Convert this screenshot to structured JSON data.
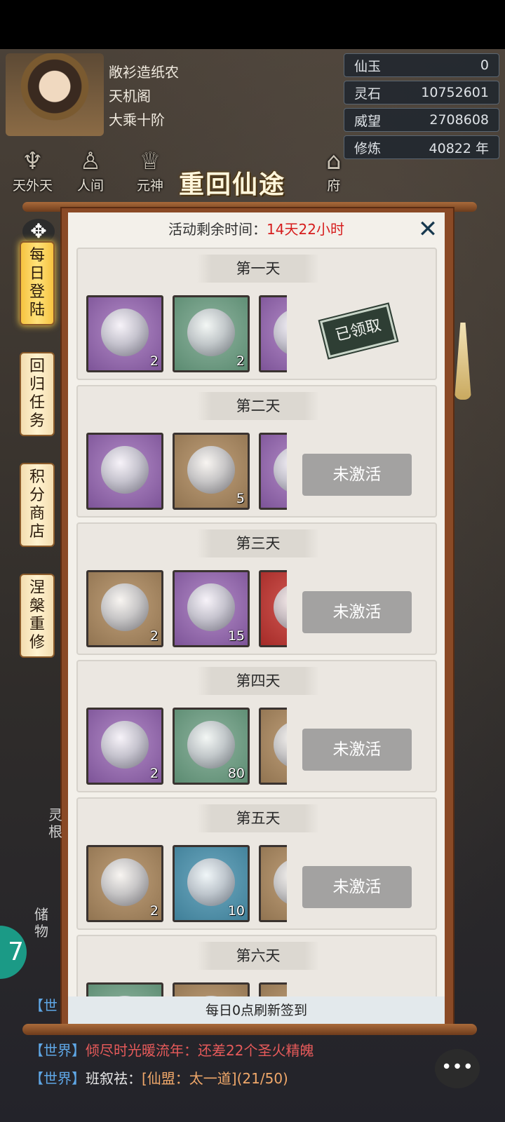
{
  "player": {
    "name": "敞衫造纸农",
    "sect": "天机阁",
    "realm": "大乘十阶"
  },
  "stats": [
    {
      "label": "仙玉",
      "value": "0"
    },
    {
      "label": "灵石",
      "value": "10752601"
    },
    {
      "label": "威望",
      "value": "2708608"
    },
    {
      "label": "修炼",
      "value": "40822 年"
    }
  ],
  "top_nav": {
    "items": [
      "天外天",
      "人间",
      "元神",
      "府"
    ],
    "title": "重回仙途"
  },
  "left_tabs": [
    {
      "label": "每日登陆",
      "active": true
    },
    {
      "label": "回归任务",
      "active": false
    },
    {
      "label": "积分商店",
      "active": false
    },
    {
      "label": "涅槃重修",
      "active": false
    }
  ],
  "dialog": {
    "timer_label": "活动剩余时间：",
    "timer_value": "14天22小时",
    "footer": "每日0点刷新签到"
  },
  "days": [
    {
      "title": "第一天",
      "status": "已领取",
      "claimed": true,
      "items": [
        {
          "color": "purple",
          "icon": "hourglass-icon",
          "count": "2"
        },
        {
          "color": "green",
          "icon": "blue-orb-icon",
          "count": "2"
        },
        {
          "color": "purple",
          "icon": "gold-ring-icon",
          "count": ""
        }
      ]
    },
    {
      "title": "第二天",
      "status": "未激活",
      "claimed": false,
      "items": [
        {
          "color": "purple",
          "icon": "butterfly-icon",
          "count": ""
        },
        {
          "color": "tan",
          "icon": "chest-icon",
          "count": "5"
        },
        {
          "color": "purple",
          "icon": "relic-icon",
          "count": ""
        }
      ]
    },
    {
      "title": "第三天",
      "status": "未激活",
      "claimed": false,
      "items": [
        {
          "color": "tan",
          "icon": "stone-icon",
          "count": "2"
        },
        {
          "color": "purple",
          "icon": "scroll-icon",
          "count": "15"
        },
        {
          "color": "red",
          "icon": "talisman-icon",
          "count": ""
        }
      ]
    },
    {
      "title": "第四天",
      "status": "未激活",
      "claimed": false,
      "items": [
        {
          "color": "purple",
          "icon": "emblem-orb-icon",
          "count": "2"
        },
        {
          "color": "green",
          "icon": "pills-icon",
          "count": "80"
        },
        {
          "color": "tan",
          "icon": "chest-icon",
          "count": ""
        }
      ]
    },
    {
      "title": "第五天",
      "status": "未激活",
      "claimed": false,
      "items": [
        {
          "color": "tan",
          "icon": "crown-icon",
          "count": "2"
        },
        {
          "color": "teal",
          "icon": "fire-orb-icon",
          "count": "10"
        },
        {
          "color": "tan",
          "icon": "chest-icon",
          "count": ""
        }
      ]
    },
    {
      "title": "第六天",
      "status": "",
      "claimed": false,
      "items": [
        {
          "color": "green",
          "icon": "item-icon",
          "count": ""
        },
        {
          "color": "tan",
          "icon": "item-icon",
          "count": ""
        },
        {
          "color": "tan",
          "icon": "item-icon",
          "count": ""
        }
      ]
    }
  ],
  "chat": [
    {
      "channel": "【世界】",
      "speaker": "倾尽时光暖流年：",
      "text": "还差22个圣火精魄"
    },
    {
      "channel": "【世界】",
      "speaker": "班叙祛：",
      "text": "[仙盟：太一道]",
      "suffix": "(21/50)"
    }
  ],
  "chat_partial": "【世",
  "side_labels": {
    "storage": "储物",
    "spirit": "灵根"
  }
}
